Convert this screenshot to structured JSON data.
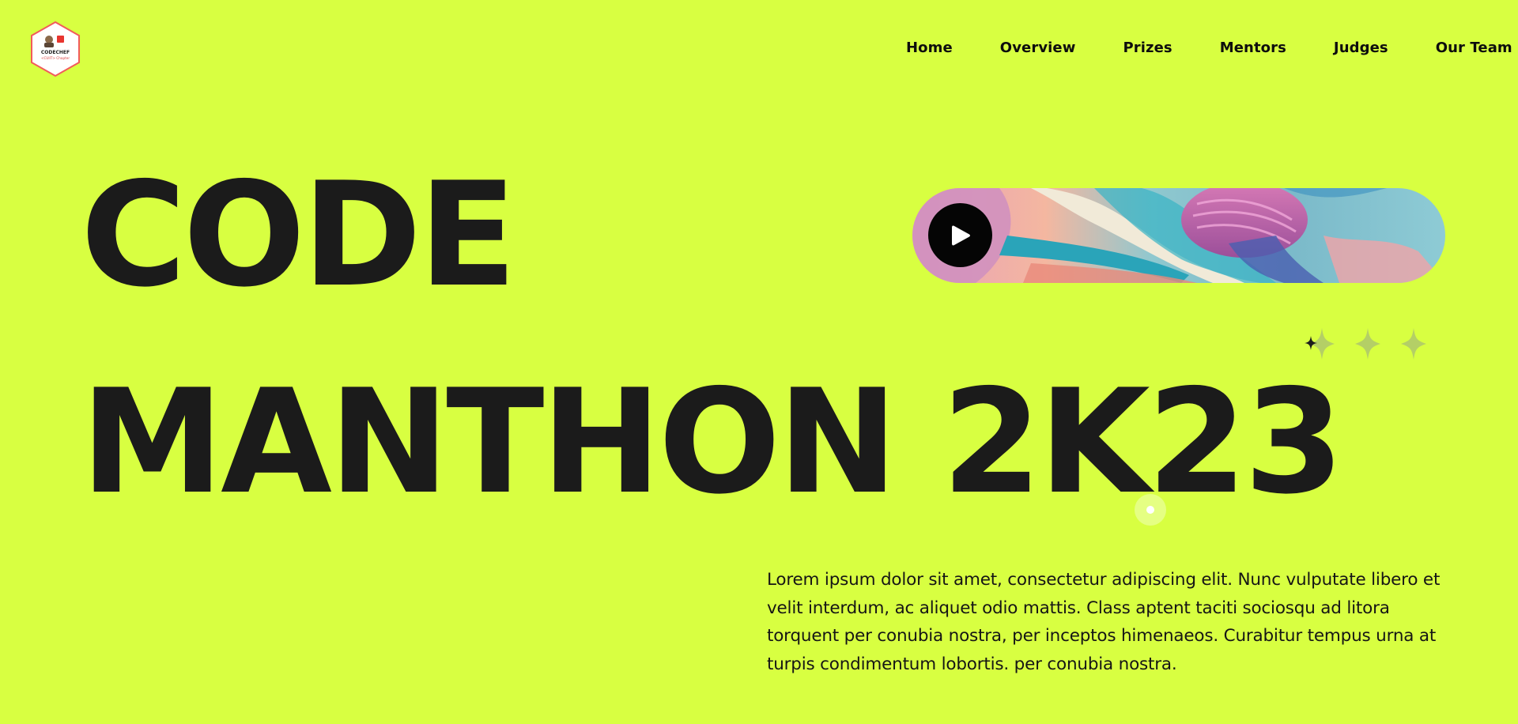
{
  "brand": {
    "logo_icon": "codechef-hexagon-logo",
    "logo_text": "CODECHEF",
    "logo_subtext": "<CUIIT> Chapter"
  },
  "nav": {
    "items": [
      {
        "label": "Home"
      },
      {
        "label": "Overview"
      },
      {
        "label": "Prizes"
      },
      {
        "label": "Mentors"
      },
      {
        "label": "Judges"
      },
      {
        "label": "Our Team"
      }
    ]
  },
  "hero": {
    "line1": "CODE",
    "line2": "MANTHON 2K23",
    "description": "Lorem ipsum dolor sit amet, consectetur adipiscing elit. Nunc vulputate libero et velit interdum, ac aliquet odio mattis. Class aptent taciti sociosqu ad litora torquent per conubia nostra, per inceptos himenaeos. Curabitur tempus urna at turpis condimentum lobortis. per conubia nostra."
  },
  "video": {
    "play_icon": "play-icon"
  },
  "decor": {
    "sparkle_icon": "sparkle-icon"
  },
  "colors": {
    "background": "#d8ff41",
    "text": "#1b1b1b",
    "play_button": "#050505"
  }
}
